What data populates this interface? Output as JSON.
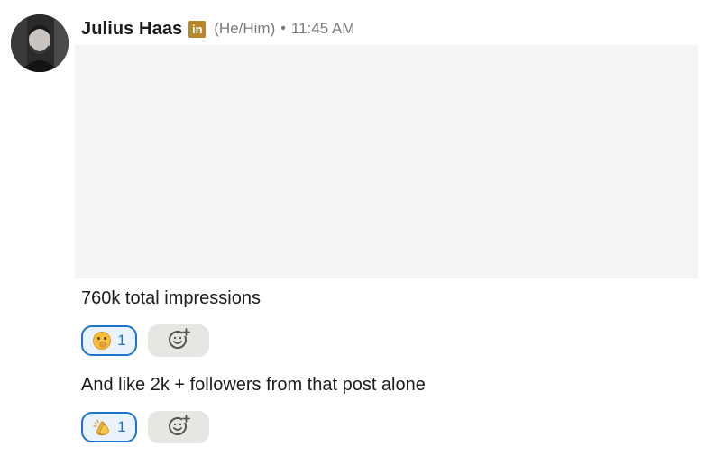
{
  "message": {
    "author_name": "Julius Haas",
    "badge_text": "in",
    "pronouns": "(He/Him)",
    "separator": "•",
    "timestamp": "11:45 AM",
    "attachment_icon": "image-placeholder"
  },
  "thread": [
    {
      "text": "760k total impressions",
      "reaction": {
        "emoji_icon": "face-with-hand-over-mouth-icon",
        "count": "1"
      },
      "add_reaction_icon": "add-reaction-icon"
    },
    {
      "text": "And like 2k + followers from that post alone",
      "reaction": {
        "emoji_icon": "clapping-hands-icon",
        "count": "1"
      },
      "add_reaction_icon": "add-reaction-icon"
    }
  ],
  "colors": {
    "reaction_border": "#1d74c9",
    "reaction_bg": "#eaf3fb",
    "add_reaction_bg": "#e8e6e3",
    "badge_bg": "#b8862b",
    "image_bg": "#f4f4f4",
    "meta_text": "#7a7a7a"
  }
}
